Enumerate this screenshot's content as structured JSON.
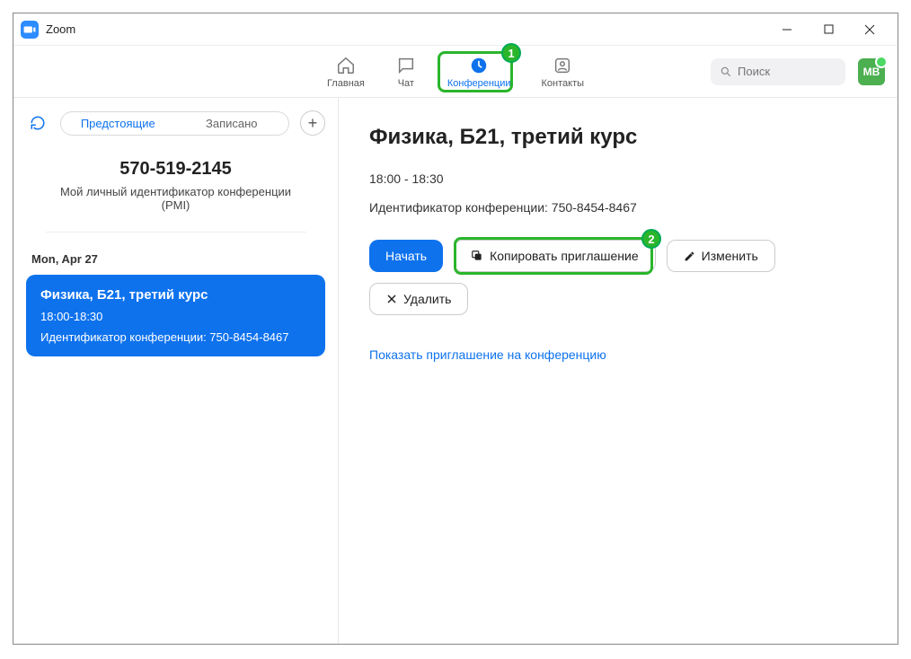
{
  "app": {
    "title": "Zoom"
  },
  "nav": {
    "home": "Главная",
    "chat": "Чат",
    "meetings": "Конференции",
    "contacts": "Контакты"
  },
  "search": {
    "placeholder": "Поиск"
  },
  "avatar": {
    "initials": "МВ"
  },
  "sidebar": {
    "tabs": {
      "upcoming": "Предстоящие",
      "recorded": "Записано"
    },
    "pmi": {
      "number": "570-519-2145",
      "label": "Мой личный идентификатор конференции (PMI)"
    },
    "date_header": "Mon, Apr 27",
    "meeting": {
      "title": "Физика, Б21, третий курс",
      "time": "18:00-18:30",
      "id_line": "Идентификатор конференции: 750-8454-8467"
    }
  },
  "detail": {
    "title": "Физика, Б21, третий курс",
    "time": "18:00 - 18:30",
    "id_line": "Идентификатор конференции: 750-8454-8467",
    "buttons": {
      "start": "Начать",
      "copy": "Копировать приглашение",
      "edit": "Изменить",
      "delete": "Удалить"
    },
    "show_invite_link": "Показать приглашение на конференцию"
  },
  "callouts": {
    "one": "1",
    "two": "2"
  }
}
